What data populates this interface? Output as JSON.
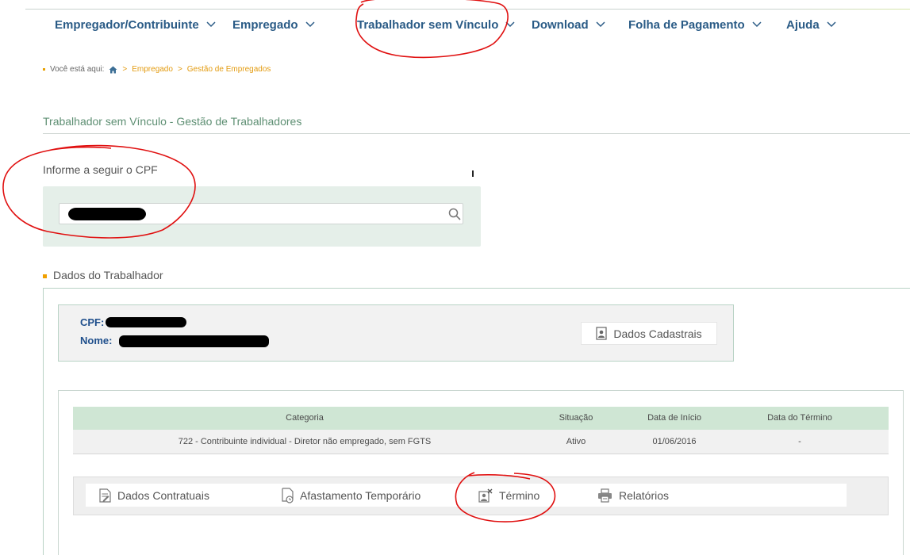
{
  "nav": {
    "items": [
      {
        "label": "Empregador/Contribuinte"
      },
      {
        "label": "Empregado"
      },
      {
        "label": "Trabalhador sem Vínculo"
      },
      {
        "label": "Download"
      },
      {
        "label": "Folha de Pagamento"
      },
      {
        "label": "Ajuda"
      }
    ]
  },
  "breadcrumb": {
    "prefix": "Você está aqui:",
    "sep1": ">",
    "item1": "Empregado",
    "sep2": ">",
    "item2": "Gestão de Empregados"
  },
  "page": {
    "title": "Trabalhador sem Vínculo - Gestão de Trabalhadores"
  },
  "search": {
    "label": "Informe a seguir o CPF",
    "value": "",
    "placeholder": ""
  },
  "worker": {
    "section_title": "Dados do Trabalhador",
    "cpf_label": "CPF:",
    "name_label": "Nome:",
    "dados_cadastrais_label": "Dados Cadastrais"
  },
  "table": {
    "headers": [
      "Categoria",
      "Situação",
      "Data de Início",
      "Data do Término"
    ],
    "rows": [
      {
        "categoria": "722 - Contribuinte individual - Diretor não empregado, sem FGTS",
        "situacao": "Ativo",
        "inicio": "01/06/2016",
        "termino": "-"
      }
    ]
  },
  "actions": {
    "dados_contratuais": "Dados Contratuais",
    "afastamento": "Afastamento Temporário",
    "termino": "Término",
    "relatorios": "Relatórios"
  },
  "colors": {
    "nav_text": "#2a5b86",
    "accent_orange": "#e39b10",
    "panel_green": "#e5efe9",
    "table_head": "#cfe6d4",
    "annotation_red": "#e01010"
  },
  "icons": {
    "chevron": "chevron-down-icon",
    "home": "home-icon",
    "search": "search-icon",
    "dados_cadastrais": "user-card-icon",
    "dados_contratuais": "document-edit-icon",
    "afastamento": "document-clock-icon",
    "termino": "user-remove-icon",
    "relatorios": "printer-icon"
  }
}
